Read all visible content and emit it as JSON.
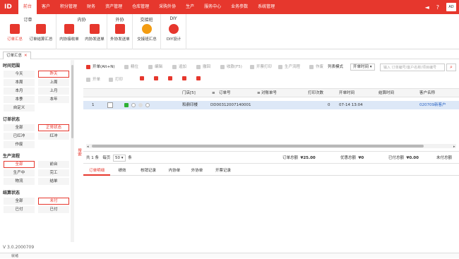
{
  "topbar": {
    "logo": "ID",
    "nav": [
      "前台",
      "客户",
      "积分管理",
      "财务",
      "资产管理",
      "仓库管理",
      "采购外协",
      "生产",
      "服务中心",
      "业务参数",
      "系统管理"
    ],
    "active_index": 0,
    "user_abbr": "AD",
    "accent": "#e6372d"
  },
  "ribbon": {
    "groups": [
      {
        "title": "订单",
        "buttons": [
          "订单汇总",
          "订单结算汇总"
        ]
      },
      {
        "title": "内协",
        "buttons": [
          "内协接收单",
          "内协发送单"
        ]
      },
      {
        "title": "外协",
        "buttons": [
          "外协发送单"
        ]
      },
      {
        "title": "交接班",
        "buttons": [
          "交接班汇总"
        ]
      },
      {
        "title": "DIY",
        "buttons": [
          "DIY设计"
        ]
      }
    ]
  },
  "doc_tab": {
    "label": "订单汇总",
    "close": "✕"
  },
  "filters": {
    "time_title": "时间范围",
    "time": [
      "今天",
      "昨天",
      "本周",
      "上周",
      "本月",
      "上月",
      "本季",
      "本年",
      "自定义"
    ],
    "order_title": "订单状态",
    "order": [
      "全部",
      "正常状态",
      "已红冲",
      "红冲",
      "作废"
    ],
    "prod_title": "生产流程",
    "prod": [
      "全部",
      "前台",
      "生产中",
      "完工",
      "物流",
      "结单"
    ],
    "settle_title": "结算状态",
    "settle": [
      "全部",
      "未付",
      "已付",
      "已付"
    ],
    "search_tab": "搜索"
  },
  "toolbar": {
    "open": "开单(Alt+N)",
    "btns": [
      "精位",
      "编辑",
      "追加",
      "撤回",
      "收款(F5)",
      "开票打印",
      "生产流程",
      "作废"
    ],
    "list_mode_label": "列表模式",
    "list_mode_value": "开单时间",
    "search_placeholder": "输入 订单编号/客户名称/项目编号",
    "row2": [
      "开单",
      "打印"
    ]
  },
  "table": {
    "columns": [
      "门店[5]",
      "订单号",
      "对账单号",
      "打印次数",
      "开单时间",
      "结算时间",
      "客户名称"
    ],
    "rows": [
      {
        "no": "1",
        "store": "和鼎印楼",
        "order_no": "DD0031200714000​1",
        "recon_no": "",
        "prints": "0",
        "open_time": "07-14 13:04",
        "settle_time": "",
        "customer": "020709新客户"
      }
    ]
  },
  "footer": {
    "total_label": "共 1 条",
    "per_page_label": "每页",
    "per_page_value": "50",
    "unit": "条",
    "order_total_label": "订单总额",
    "order_total": "¥25.00",
    "discount_label": "优惠总额",
    "discount": "¥0",
    "paid_label": "已付总额",
    "paid": "¥0.00",
    "unpaid_label": "未付总额"
  },
  "detail_tabs": [
    "订单明细",
    "绩效",
    "核销记录",
    "内协单",
    "外协单",
    "开票记录"
  ],
  "version": "V 3.0.2000709",
  "status": "就绪"
}
